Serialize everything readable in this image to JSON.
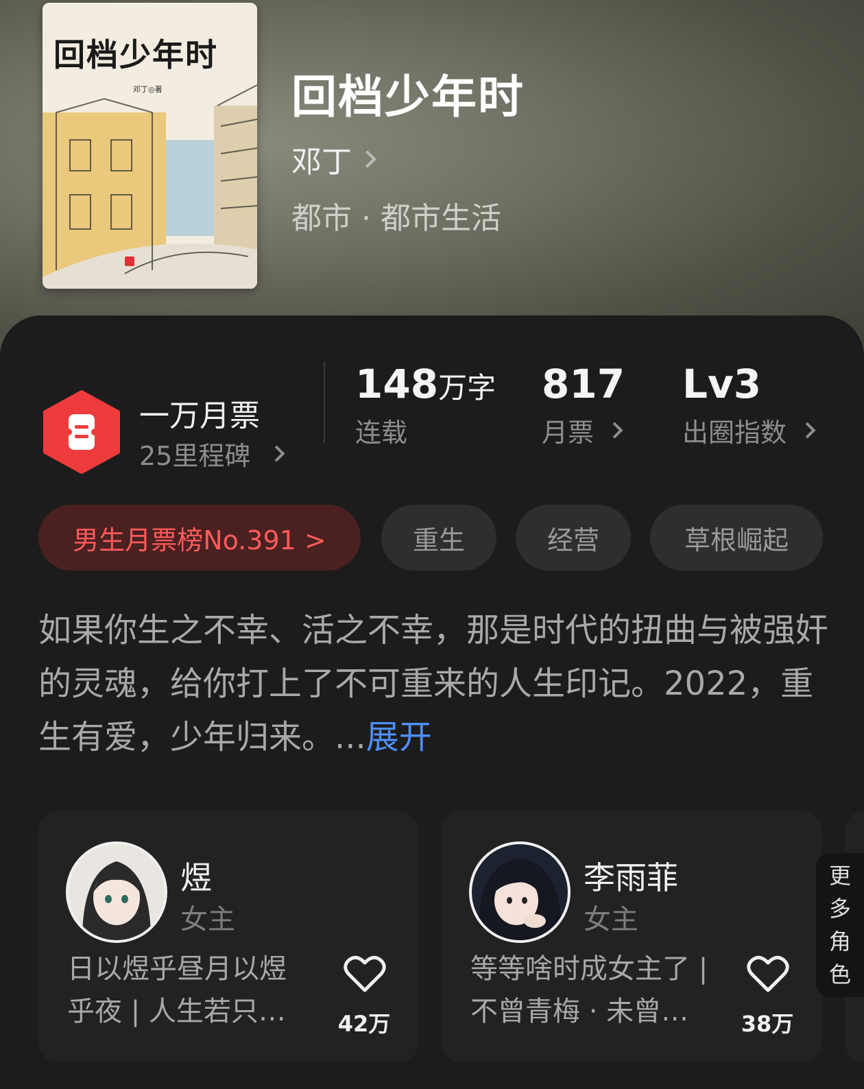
{
  "book": {
    "title": "回档少年时",
    "author": "邓丁",
    "genre": "都市 · 都市生活",
    "cover_title": "回档少年时",
    "cover_author": "邓丁◎著"
  },
  "milestone": {
    "title": "一万月票",
    "subtitle": "25里程碑",
    "icon": "ticket-hexagon-icon",
    "color": "#ee3b3b"
  },
  "stats": [
    {
      "value": "148",
      "unit": "万字",
      "label": "连载",
      "has_arrow": false
    },
    {
      "value": "817",
      "unit": "",
      "label": "月票",
      "has_arrow": true
    },
    {
      "value": "Lv3",
      "unit": "",
      "label": "出圈指数",
      "has_arrow": true
    }
  ],
  "rank_chip": {
    "label": "男生月票榜No.391 >"
  },
  "tags": [
    "重生",
    "经营",
    "草根崛起"
  ],
  "description": {
    "text": "如果你生之不幸、活之不幸，那是时代的扭曲与被强奸的灵魂，给你打上了不可重来的人生印记。2022，重生有爱，少年归来。...",
    "expand": "展开",
    "expand_color": "#4f8ef7"
  },
  "characters": [
    {
      "name": "煜",
      "role": "女主",
      "quote": "日以煜乎昼月以煜乎夜 | 人生若只…",
      "likes": "42万"
    },
    {
      "name": "李雨菲",
      "role": "女主",
      "quote": "等等啥时成女主了 | 不曾青梅 · 未曾…",
      "likes": "38万"
    }
  ],
  "more_roles": [
    "更",
    "多",
    "角",
    "色"
  ]
}
